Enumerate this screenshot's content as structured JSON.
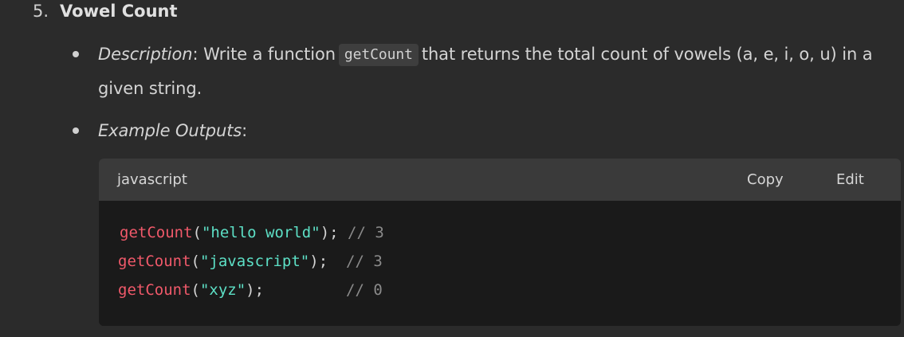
{
  "section": {
    "number": "5.",
    "title": "Vowel Count"
  },
  "description": {
    "label": "Description",
    "sep": ":",
    "text_before": " Write a function",
    "code": "getCount",
    "text_after_line1": "that returns the total count of vowels (a, e, i, o, u) in a",
    "text_line2": "given string."
  },
  "examples": {
    "label": "Example Outputs",
    "sep": ":"
  },
  "codeblock": {
    "language": "javascript",
    "copy_label": "Copy",
    "edit_label": "Edit",
    "lines": [
      {
        "fn": "getCount",
        "open": "(",
        "arg": "\"hello world\"",
        "close": ");",
        "gap": " ",
        "comment": "// 3"
      },
      {
        "fn": "getCount",
        "open": "(",
        "arg": "\"javascript\"",
        "close": ");",
        "gap": "  ",
        "comment": "// 3"
      },
      {
        "fn": "getCount",
        "open": "(",
        "arg": "\"xyz\"",
        "close": ");",
        "gap": "         ",
        "comment": "// 0"
      }
    ]
  },
  "colors": {
    "function": "#f0596a",
    "string": "#5de0c6",
    "comment": "#8a8a8a",
    "background": "#2b2b2b",
    "code_background": "#1a1a1a"
  }
}
